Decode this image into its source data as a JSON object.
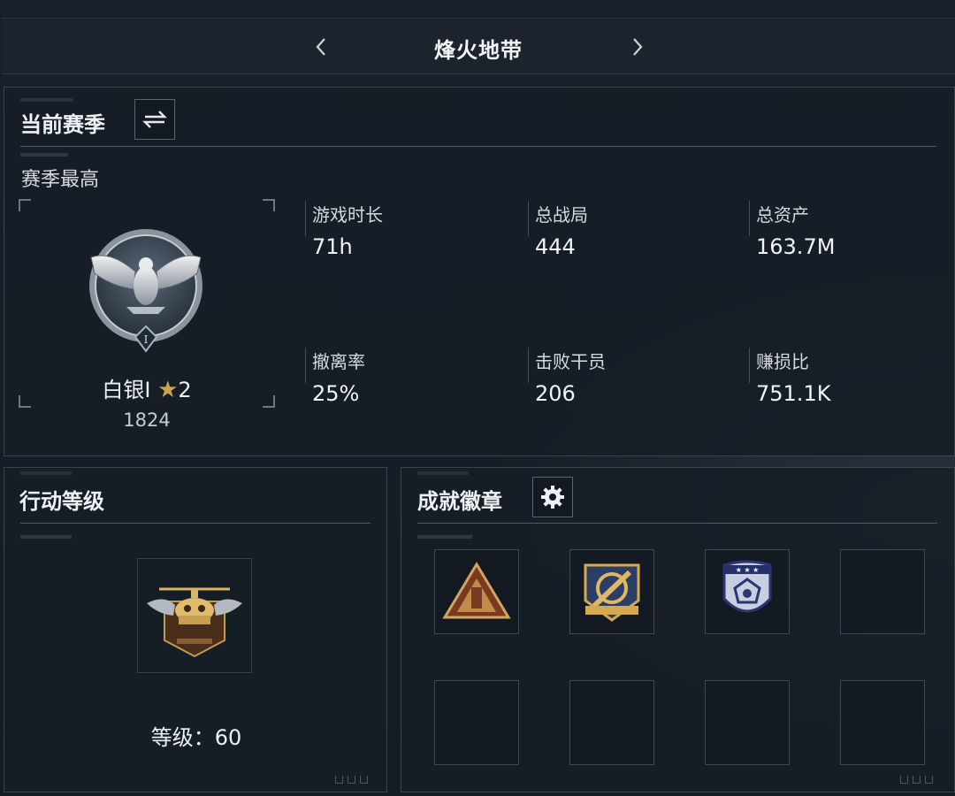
{
  "header": {
    "title": "烽火地带",
    "prev_icon": "chevron-left-icon",
    "next_icon": "chevron-right-icon"
  },
  "season": {
    "title": "当前赛季",
    "switch_icon": "swap-icon",
    "subtitle": "赛季最高",
    "rank": {
      "name": "白银I",
      "stars": "2",
      "score": "1824",
      "emblem_numeral": "I"
    },
    "stats": [
      {
        "label": "游戏时长",
        "value": "71h"
      },
      {
        "label": "总战局",
        "value": "444"
      },
      {
        "label": "总资产",
        "value": "163.7M"
      },
      {
        "label": "撤离率",
        "value": "25%"
      },
      {
        "label": "击败干员",
        "value": "206"
      },
      {
        "label": "赚损比",
        "value": "751.1K"
      }
    ]
  },
  "action_level": {
    "title": "行动等级",
    "level_text": "等级：60"
  },
  "achievements": {
    "title": "成就徽章",
    "settings_icon": "gear-icon",
    "badges": [
      {
        "icon": "triangle-badge-icon",
        "filled": true
      },
      {
        "icon": "crosshair-shield-badge-icon",
        "filled": true
      },
      {
        "icon": "blue-crest-badge-icon",
        "filled": true
      },
      {
        "icon": "empty-slot",
        "filled": false
      },
      {
        "icon": "empty-slot",
        "filled": false
      },
      {
        "icon": "empty-slot",
        "filled": false
      },
      {
        "icon": "empty-slot",
        "filled": false
      },
      {
        "icon": "empty-slot",
        "filled": false
      }
    ]
  },
  "colors": {
    "background": "#131a22",
    "panel_border": "#3a444f",
    "text_primary": "#f2f4f6",
    "accent_gold": "#c9a44a"
  }
}
